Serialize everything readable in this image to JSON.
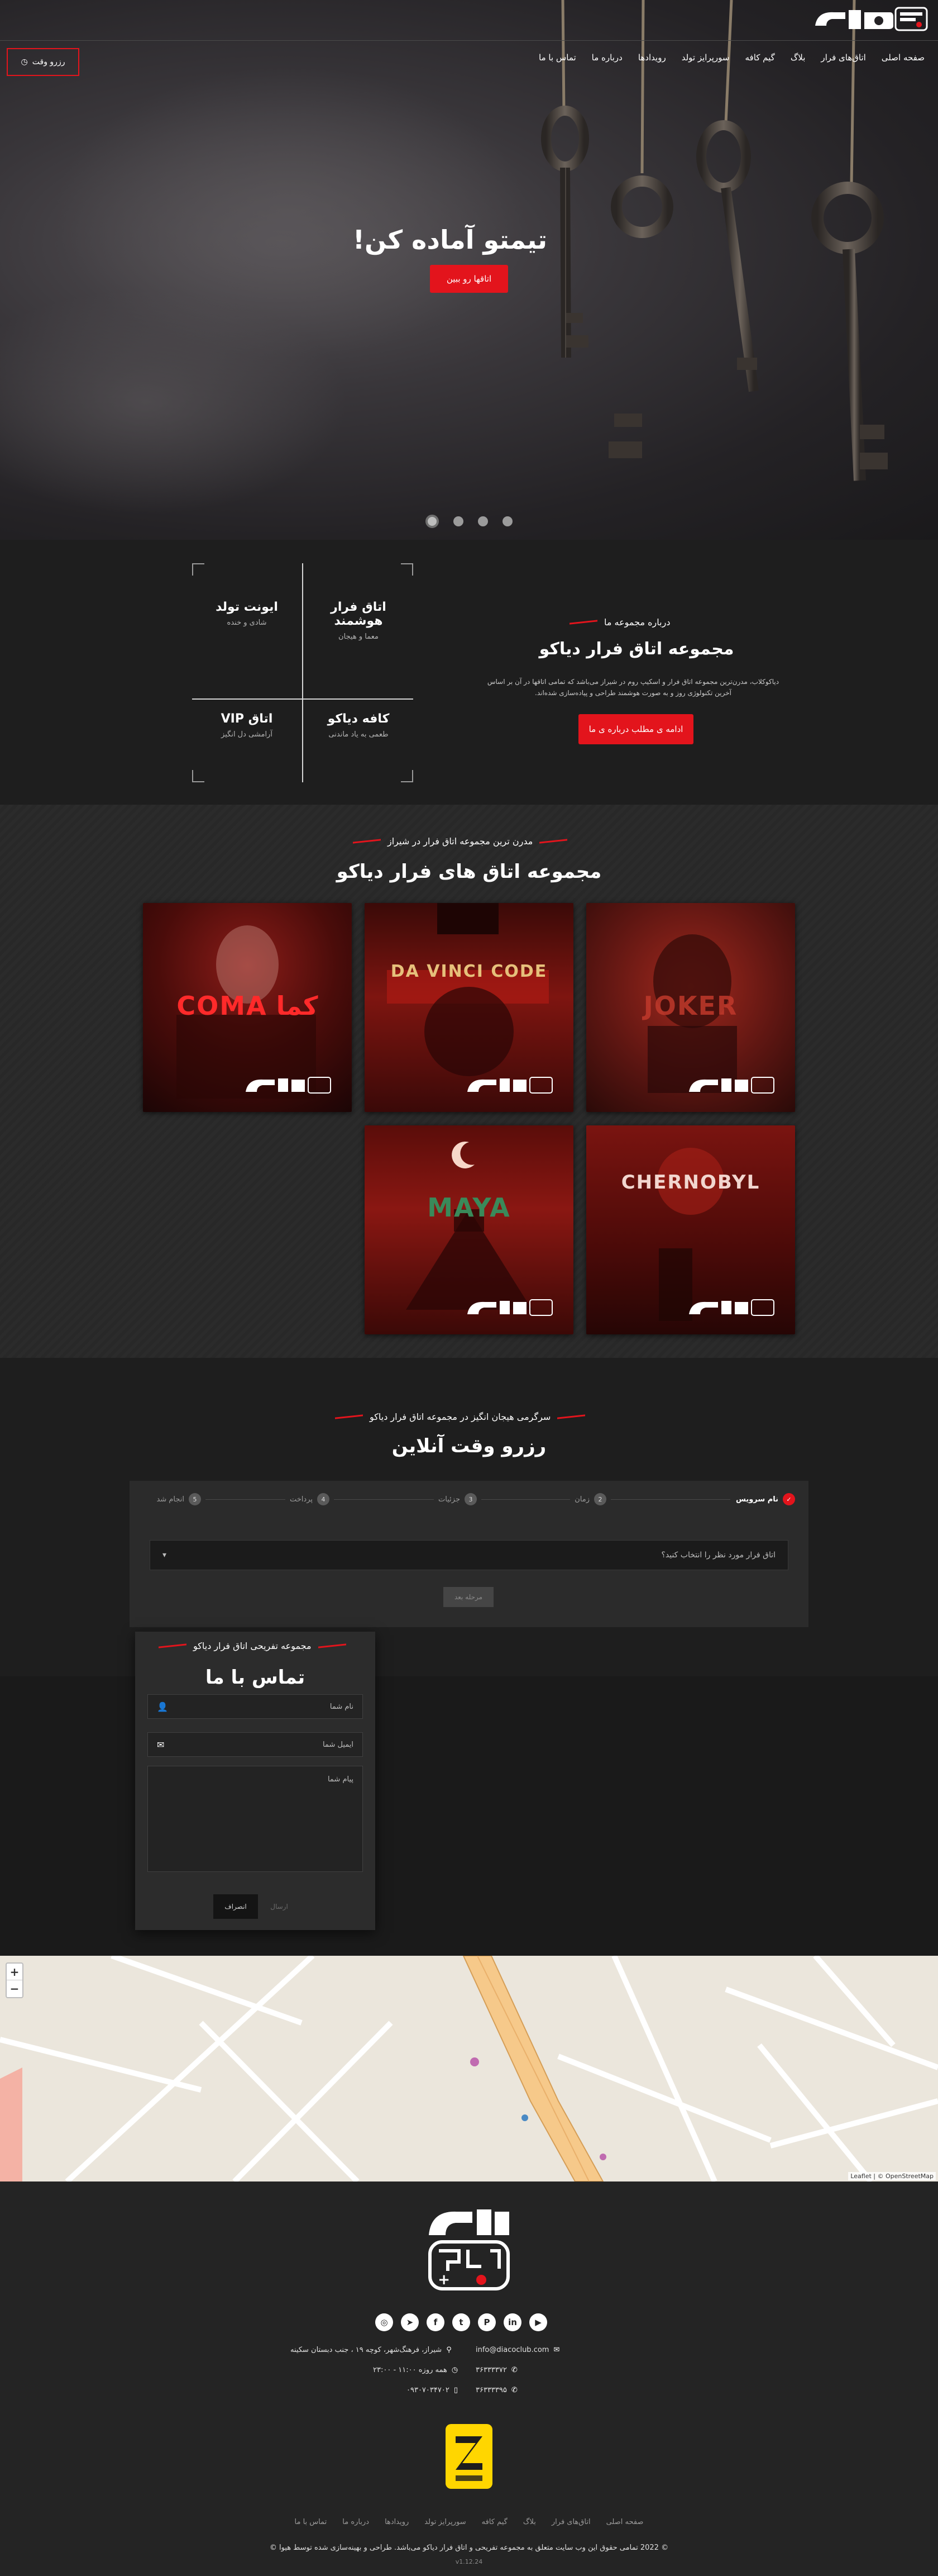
{
  "header": {
    "nav": [
      "صفحه اصلی",
      "اتاق‌های فرار",
      "بلاگ",
      "گیم کافه",
      "سورپرایز تولد",
      "رویدادها",
      "درباره ما",
      "تماس با ما"
    ],
    "reserve_button": "رزرو وقت"
  },
  "hero": {
    "title": "تیمتو آماده کن!",
    "button": "اتاقها رو ببین",
    "slide_count": 4,
    "active_slide": 1
  },
  "about": {
    "features": [
      {
        "title": "اتاق فرار هوشمند",
        "subtitle": "معما و هیجان"
      },
      {
        "title": "ایونت تولد",
        "subtitle": "شادی و خنده"
      },
      {
        "title": "کافه دیاکو",
        "subtitle": "طعمی به یاد ماندنی"
      },
      {
        "title": "اتاق VIP",
        "subtitle": "آرامشی دل انگیز"
      }
    ],
    "label": "درباره مجموعه ما",
    "title": "مجموعه اتاق فرار دیاکو",
    "text": "دیاکوکلاب، مدرن‌ترین مجموعه اتاق فرار و اسکیپ روم در شیراز می‌باشد که تمامی اتاقها در آن بر اساس آخرین تکنولوژی روز و به صورت هوشمند طراحی و پیاده‌سازی شده‌اند.",
    "button": "ادامه ی مطلب درباره ی ما"
  },
  "rooms": {
    "label": "مدرن ترین مجموعه اتاق فرار در شیراز",
    "title": "مجموعه اتاق های فرار دیاکو",
    "items": [
      {
        "name": "JOKER",
        "theme": "joker"
      },
      {
        "name": "DA VINCI CODE",
        "theme": "davinci"
      },
      {
        "name": "کما COMA",
        "theme": "coma"
      },
      {
        "name": "CHERNOBYL",
        "theme": "chernobyl"
      },
      {
        "name": "MAYA",
        "theme": "maya"
      }
    ]
  },
  "reservation": {
    "label": "سرگرمی هیجان انگیز در مجموعه اتاق فرار دیاکو",
    "title": "رزرو وقت آنلاین",
    "steps": [
      {
        "num": "✓",
        "label": "نام سرویس",
        "active": true
      },
      {
        "num": "2",
        "label": "زمان"
      },
      {
        "num": "3",
        "label": "جزئیات"
      },
      {
        "num": "4",
        "label": "پرداخت"
      },
      {
        "num": "5",
        "label": "انجام شد"
      }
    ],
    "select_placeholder": "اتاق فرار مورد نظر را انتخاب کنید؟",
    "next_button": "مرحله بعد"
  },
  "contact": {
    "label": "مجموعه تفریحی اتاق فرار دیاکو",
    "title": "تماس با ما",
    "name_placeholder": "نام شما",
    "email_placeholder": "ایمیل شما",
    "message_placeholder": "پیام شما",
    "send_button": "ارسال",
    "cancel_button": "انصراف"
  },
  "map": {
    "zoom_in": "+",
    "zoom_out": "−",
    "attribution": "Leaflet | © OpenStreetMap"
  },
  "footer": {
    "socials": [
      "instagram",
      "telegram",
      "facebook",
      "twitter",
      "pinterest",
      "linkedin",
      "youtube"
    ],
    "email": "info@diacoclub.com",
    "address": "شیراز، فرهنگ‌شهر، کوچه ۱۹ ، جنب دبستان سکینه",
    "hours": "همه روزه ۱۱:۰۰ - ۲۳:۰۰",
    "phone1": "۳۶۳۳۳۳۷۲",
    "phone2": "۳۶۳۳۳۳۹۵",
    "mobile": "۰۹۳۰۷۰۳۴۷۰۲",
    "links": [
      "صفحه اصلی",
      "اتاق‌های فرار",
      "بلاگ",
      "گیم کافه",
      "سورپرایز تولد",
      "رویدادها",
      "درباره ما",
      "تماس با ما"
    ],
    "copyright": "© 2022 تمامی حقوق این وب سایت متعلق به مجموعه تفریحی و اتاق فرار دیاکو می‌باشد. طراحی و بهینه‌سازی شده توسط هیوا ©",
    "version": "v1.12.24"
  },
  "colors": {
    "accent": "#e3141c",
    "bg_dark": "#1e1e1e",
    "panel": "#2b2b2b"
  }
}
